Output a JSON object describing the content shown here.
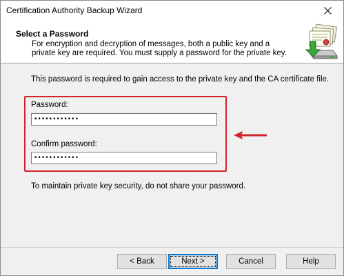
{
  "window": {
    "title": "Certification Authority Backup Wizard",
    "close_glyph": "✕"
  },
  "header": {
    "title": "Select a Password",
    "description": "For encryption and decryption of messages, both a public key and a private key are required. You must supply a password for the private key.",
    "icon": "certificate-backup-icon"
  },
  "main": {
    "intro": "This password is required to gain access to the private key and the CA certificate file.",
    "password_label": "Password:",
    "password_value": "••••••••••••",
    "confirm_label": "Confirm password:",
    "confirm_value": "••••••••••••",
    "note": "To maintain private key security, do not share your password."
  },
  "annotation": {
    "highlight_color": "#d2232a",
    "arrow_icon": "red-arrow-left-icon"
  },
  "footer": {
    "back_label": "< Back",
    "next_label": "Next >",
    "cancel_label": "Cancel",
    "help_label": "Help"
  },
  "colors": {
    "accent": "#0078d7",
    "header_bg": "#ffffff",
    "body_bg": "#f0f0f0"
  }
}
